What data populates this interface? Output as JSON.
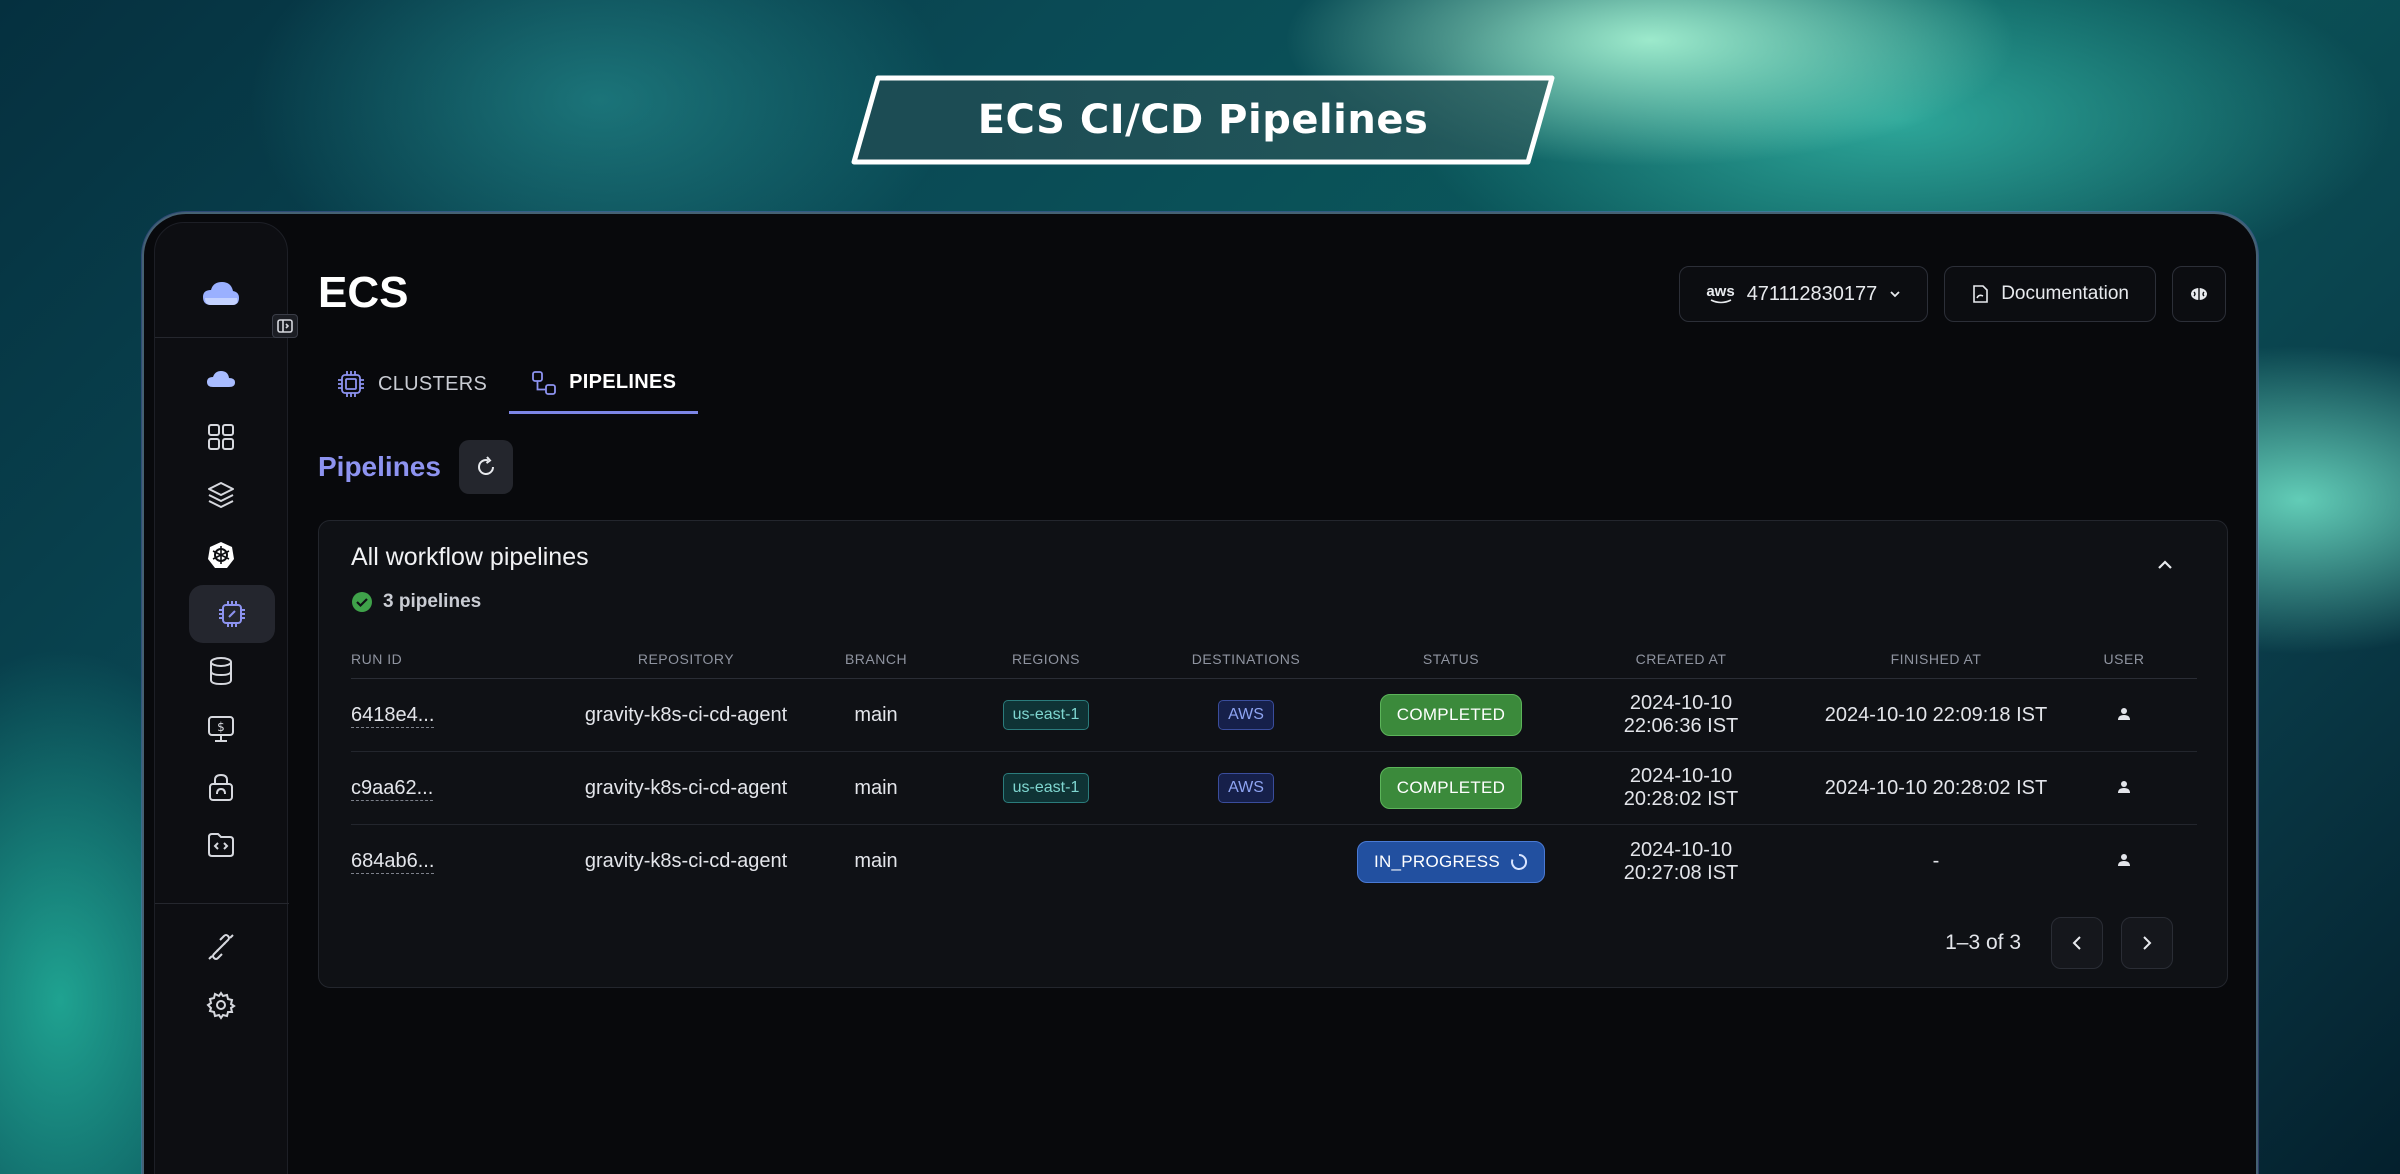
{
  "banner": {
    "title": "ECS CI/CD Pipelines"
  },
  "sidebar": {
    "items": [
      {
        "icon": "cloud-icon"
      },
      {
        "icon": "grid-icon"
      },
      {
        "icon": "layers-icon"
      },
      {
        "icon": "kubernetes-icon"
      },
      {
        "icon": "ecs-chip-icon",
        "active": true
      },
      {
        "icon": "database-icon"
      },
      {
        "icon": "billing-icon"
      },
      {
        "icon": "security-icon"
      },
      {
        "icon": "code-folder-icon"
      },
      {
        "icon": "integrations-icon"
      },
      {
        "icon": "settings-icon"
      }
    ]
  },
  "header": {
    "title": "ECS",
    "account_label": "471112830177",
    "account_provider": "aws",
    "docs_label": "Documentation"
  },
  "tabs": [
    {
      "label": "CLUSTERS",
      "active": false
    },
    {
      "label": "PIPELINES",
      "active": true
    }
  ],
  "section": {
    "title": "Pipelines"
  },
  "panel": {
    "title": "All workflow pipelines",
    "count_label": "3 pipelines"
  },
  "table": {
    "columns": [
      "RUN ID",
      "REPOSITORY",
      "BRANCH",
      "REGIONS",
      "DESTINATIONS",
      "STATUS",
      "CREATED AT",
      "FINISHED AT",
      "USER"
    ],
    "rows": [
      {
        "run_id": "6418e4...",
        "repository": "gravity-k8s-ci-cd-agent",
        "branch": "main",
        "region": "us-east-1",
        "destination": "AWS",
        "status": "COMPLETED",
        "created_at": "2024-10-10 22:06:36 IST",
        "finished_at": "2024-10-10 22:09:18 IST"
      },
      {
        "run_id": "c9aa62...",
        "repository": "gravity-k8s-ci-cd-agent",
        "branch": "main",
        "region": "us-east-1",
        "destination": "AWS",
        "status": "COMPLETED",
        "created_at": "2024-10-10 20:28:02 IST",
        "finished_at": "2024-10-10 20:28:02 IST"
      },
      {
        "run_id": "684ab6...",
        "repository": "gravity-k8s-ci-cd-agent",
        "branch": "main",
        "region": "",
        "destination": "",
        "status": "IN_PROGRESS",
        "created_at": "2024-10-10 20:27:08 IST",
        "finished_at": "-"
      }
    ]
  },
  "pagination": {
    "label": "1–3 of 3"
  },
  "colors": {
    "accent": "#8d93f0",
    "completed": "#3b8a3b",
    "in_progress": "#2250a0"
  }
}
